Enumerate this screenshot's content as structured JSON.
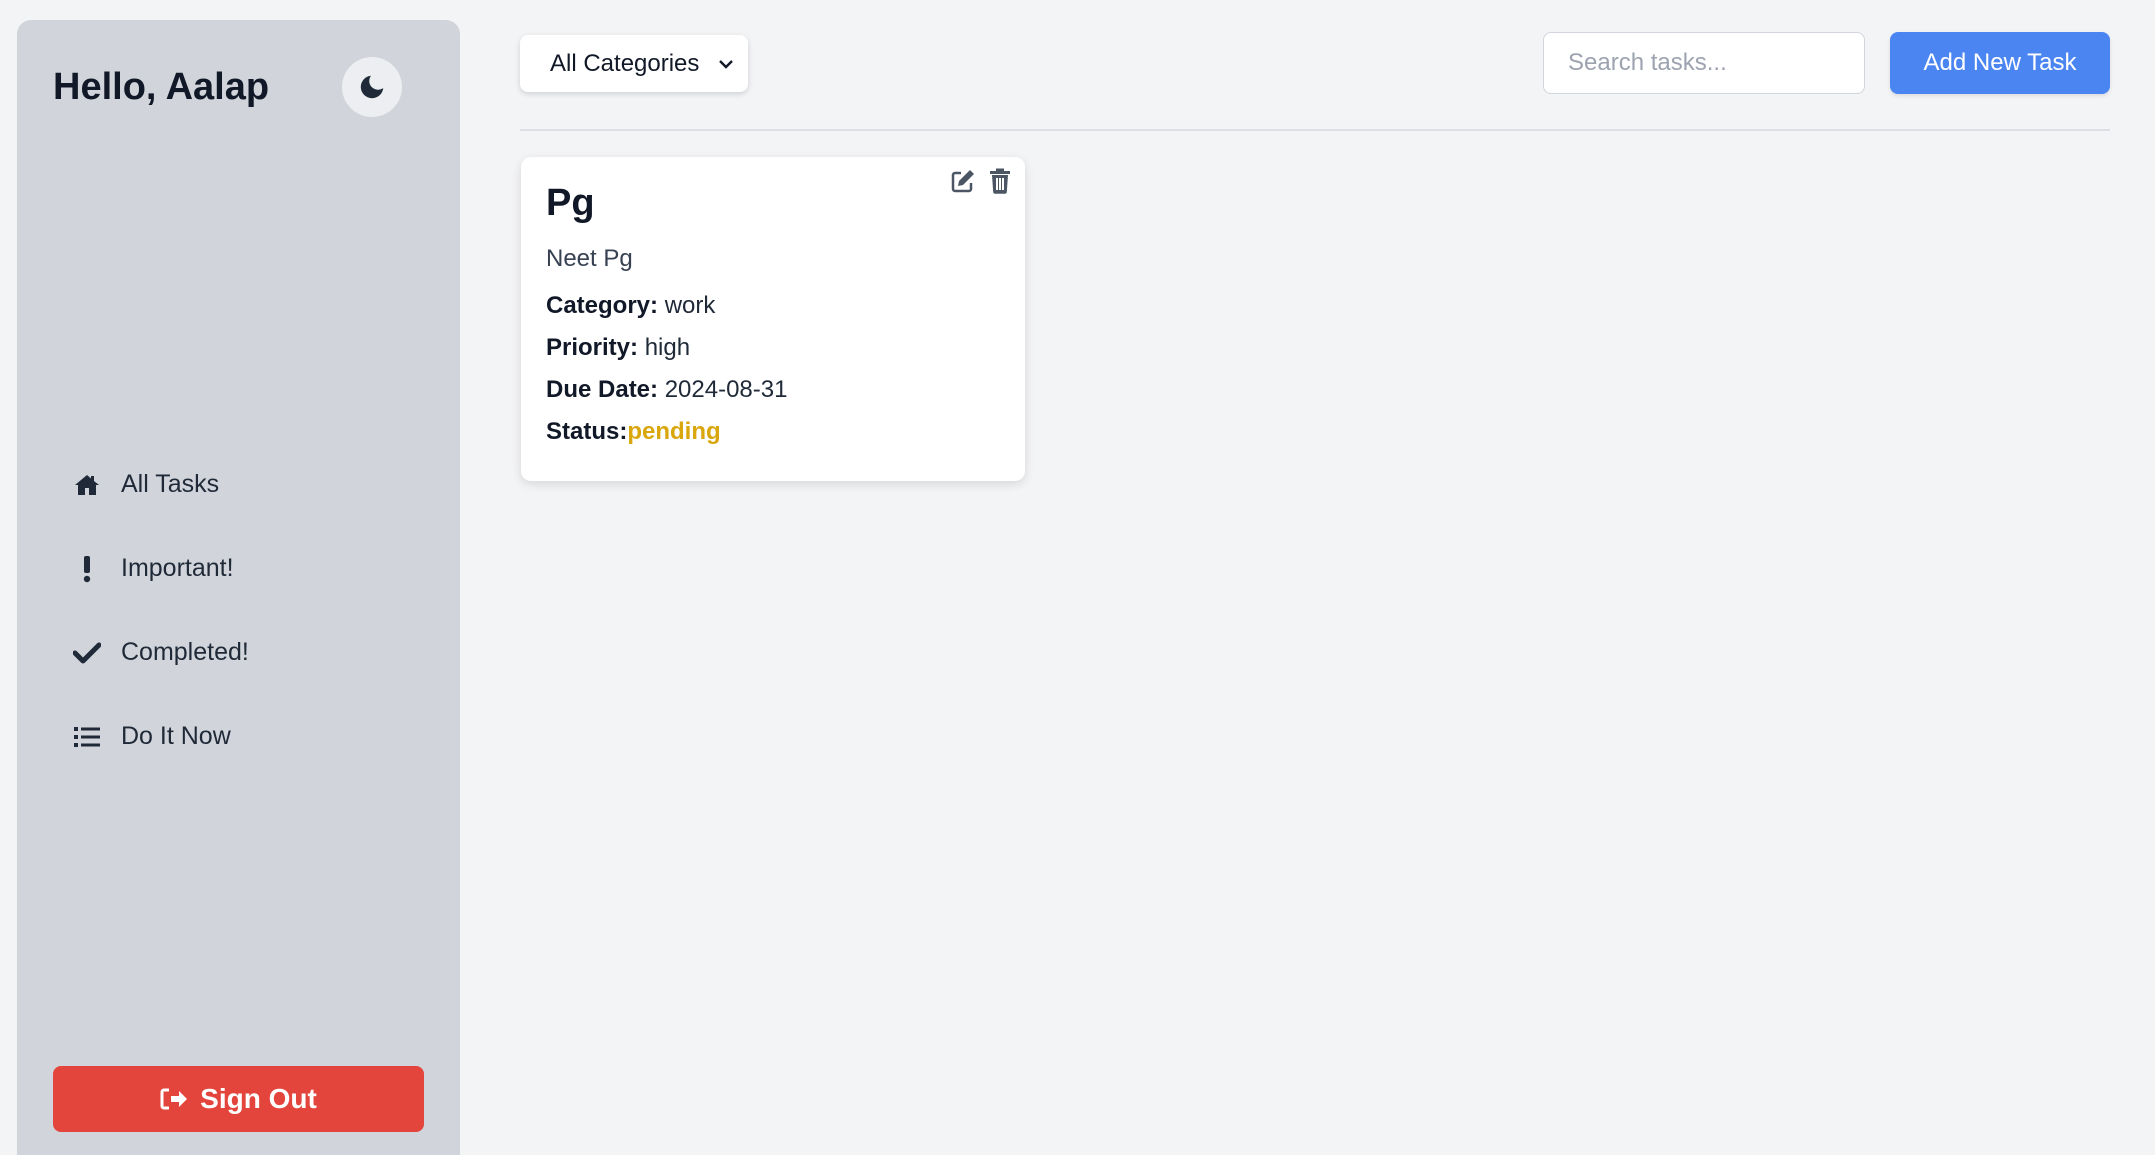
{
  "sidebar": {
    "greeting": "Hello, Aalap",
    "theme_toggle_icon": "moon-icon",
    "items": [
      {
        "label": "All Tasks",
        "icon": "home-icon"
      },
      {
        "label": "Important!",
        "icon": "exclamation-icon"
      },
      {
        "label": "Completed!",
        "icon": "check-icon"
      },
      {
        "label": "Do It Now",
        "icon": "list-icon"
      }
    ],
    "signout_label": "Sign Out"
  },
  "toolbar": {
    "category_selected": "All Categories",
    "search_placeholder": "Search tasks...",
    "add_label": "Add New Task"
  },
  "tasks": [
    {
      "title": "Pg",
      "description": "Neet Pg",
      "category_label": "Category:",
      "category": "work",
      "priority_label": "Priority:",
      "priority": "high",
      "due_label": "Due Date:",
      "due_date": "2024-08-31",
      "status_label": "Status:",
      "status": "pending"
    }
  ],
  "colors": {
    "accent": "#4b85f2",
    "danger": "#e3443c",
    "pending": "#d9a60b",
    "sidebar_bg": "#d1d5db"
  }
}
